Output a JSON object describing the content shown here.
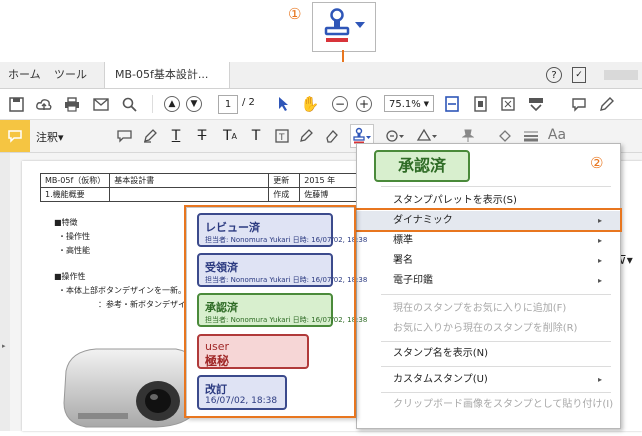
{
  "callouts": {
    "one": "①",
    "two": "②"
  },
  "tabs": {
    "home": "ホーム",
    "tools": "ツール",
    "doc": "MB-05f基本設計..."
  },
  "toolbar": {
    "page_current": "1",
    "page_total": "/ 2",
    "zoom": "75.1%"
  },
  "annot": {
    "label": "注釈▾"
  },
  "document": {
    "row1": [
      "MB-05f（仮称）",
      "基本設計書",
      "更新",
      "2015 年"
    ],
    "row2": [
      "1.機能概要",
      "",
      "作成",
      "佐藤博"
    ],
    "lines": [
      "■特徴",
      "・操作性",
      "・高性能",
      "■操作性",
      "・本体上部ボタンデザインを一新。",
      "：参考・新ボタンデザイン"
    ]
  },
  "menu": {
    "preview": "承認済",
    "items": [
      {
        "label": "スタンプパレットを表示(S)",
        "state": "normal",
        "arrow": ""
      },
      {
        "label": "ダイナミック",
        "state": "selected",
        "arrow": "▸"
      },
      {
        "label": "標準",
        "state": "normal",
        "arrow": "▸"
      },
      {
        "label": "署名",
        "state": "normal",
        "arrow": "▸"
      },
      {
        "label": "電子印鑑",
        "state": "normal",
        "arrow": "▸"
      },
      {
        "label": "現在のスタンプをお気に入りに追加(F)",
        "state": "disabled",
        "arrow": ""
      },
      {
        "label": "お気に入りから現在のスタンプを削除(R)",
        "state": "disabled",
        "arrow": ""
      },
      {
        "label": "スタンプ名を表示(N)",
        "state": "normal",
        "arrow": ""
      },
      {
        "label": "カスタムスタンプ(U)",
        "state": "normal",
        "arrow": "▸"
      },
      {
        "label": "クリップボード画像をスタンプとして貼り付け(I)",
        "state": "disabled",
        "arrow": ""
      }
    ]
  },
  "stamps": [
    {
      "title": "レビュー済",
      "sub": "担当者: Nonomura Yukari 日時: 16/07/02, 18:38",
      "fill": "#dfe3f4",
      "border": "#3b4a8c",
      "color": "#2b3a80"
    },
    {
      "title": "受領済",
      "sub": "担当者: Nonomura Yukari 日時: 16/07/02, 18:38",
      "fill": "#dfe3f4",
      "border": "#3b4a8c",
      "color": "#2b3a80"
    },
    {
      "title": "承認済",
      "sub": "担当者: Nonomura Yukari 日時: 16/07/02, 18:38",
      "fill": "#d8efce",
      "border": "#4a8a3a",
      "color": "#2e6b25"
    },
    {
      "title": "user",
      "sub": "極秘",
      "fill": "#f6d6d6",
      "border": "#b03a3a",
      "color": "#a02828"
    },
    {
      "title": "改訂",
      "sub": "16/07/02, 18:38",
      "fill": "#dfe3f4",
      "border": "#3b4a8c",
      "color": "#2b3a80"
    }
  ],
  "colors": {
    "accent": "#e8761f",
    "highlight": "#f5c542"
  }
}
